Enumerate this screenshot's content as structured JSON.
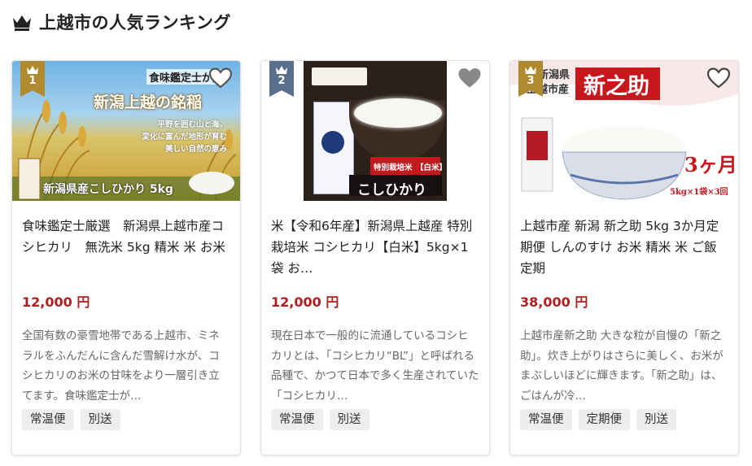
{
  "section": {
    "title": "上越市の人気ランキング",
    "icon": "crown-icon"
  },
  "colors": {
    "price": "#b21d1d",
    "rank1": "#b08a2e",
    "rank2": "#5a6f8c",
    "rank3": "#b08a2e"
  },
  "cards": [
    {
      "rank": "1",
      "name": "食味鑑定士厳選　新潟県上越市産コシヒカリ　無洗米 5kg 精米 米 お米",
      "price": "12,000 円",
      "description": "全国有数の豪雪地帯である上越市、ミネラルをふんだんに含んだ雪解け水が、コシヒカリのお米の甘味をより一層引き立てます。食味鑑定士が…",
      "tags": [
        "常温便",
        "別送"
      ],
      "image_text": {
        "line1": "食味鑑定士が選",
        "line2": "新潟上越の銘稲",
        "line3": "平野を囲む山と海。",
        "line4": "変化に富んだ地形が育む",
        "line5": "美しい自然の恵み",
        "line6": "新潟県産こしひかり 5kg"
      }
    },
    {
      "rank": "2",
      "name": "米【令和6年産】新潟県上越産 特別栽培米 コシヒカリ【白米】5kg×1袋 お…",
      "price": "12,000 円",
      "description": "現在日本で一般的に流通しているコシヒカリとは、「コシヒカリ“BL”」と呼ばれる品種で、かつて日本で多く生産されていた「コシヒカリ…",
      "tags": [
        "常温便",
        "別送"
      ],
      "image_text": {
        "line1": "特別栽培米",
        "line2": "【白米】",
        "line3": "こしひかり"
      }
    },
    {
      "rank": "3",
      "name": "上越市産 新潟 新之助 5kg 3か月定期便 しんのすけ お米 精米 米 ご飯 定期",
      "price": "38,000 円",
      "description": "上越市産新之助 大きな粒が自慢の「新之助」。炊き上がりはさらに美しく、お米がまぶしいほどに輝きます。「新之助」は、ごはんが冷…",
      "tags": [
        "常温便",
        "定期便",
        "別送"
      ],
      "image_text": {
        "line1": "新潟県",
        "line2": "上越市産",
        "line3": "新之助",
        "line4": "3ヶ月",
        "line5": "5kg×1袋×3回"
      }
    }
  ]
}
